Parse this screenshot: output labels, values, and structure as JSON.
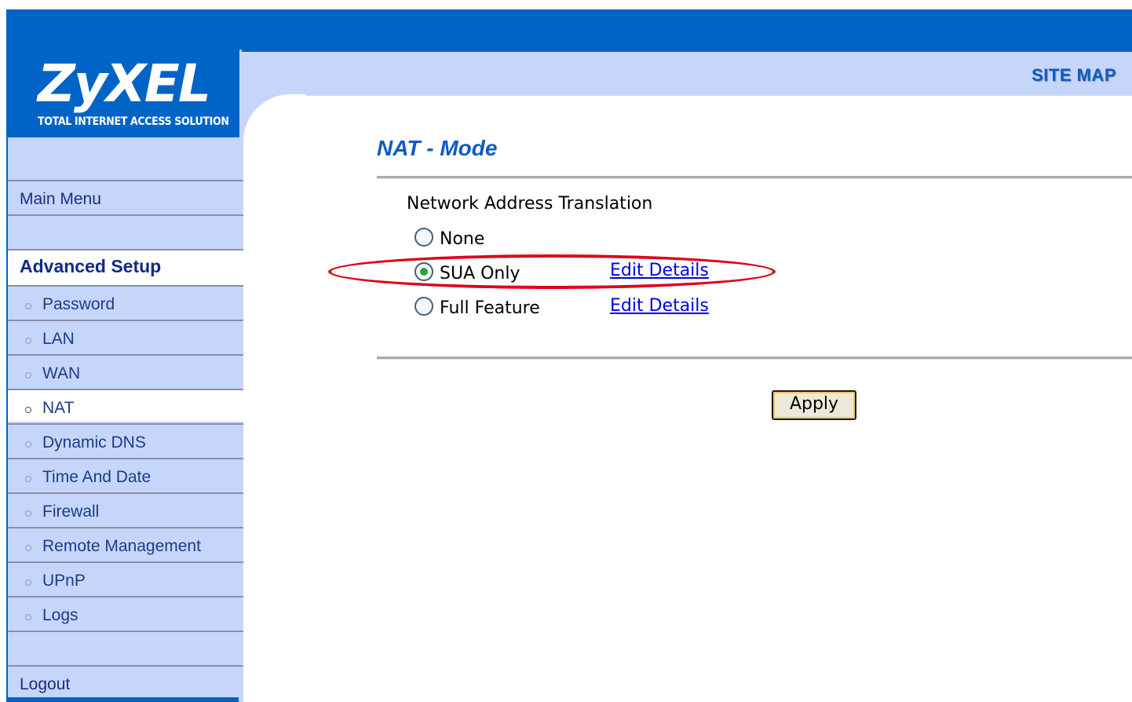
{
  "brand": {
    "logo_text": "ZyXEL",
    "tagline": "TOTAL INTERNET ACCESS SOLUTION",
    "primary_color": "#0063c6",
    "light_color": "#c6d6fb"
  },
  "header": {
    "site_map_label": "SITE MAP"
  },
  "sidebar": {
    "main_menu": "Main Menu",
    "section_title": "Advanced Setup",
    "items": [
      {
        "label": "Password",
        "active": false
      },
      {
        "label": "LAN",
        "active": false
      },
      {
        "label": "WAN",
        "active": false
      },
      {
        "label": "NAT",
        "active": true
      },
      {
        "label": "Dynamic DNS",
        "active": false
      },
      {
        "label": "Time And Date",
        "active": false
      },
      {
        "label": "Firewall",
        "active": false
      },
      {
        "label": "Remote Management",
        "active": false
      },
      {
        "label": "UPnP",
        "active": false
      },
      {
        "label": "Logs",
        "active": false
      }
    ],
    "logout": "Logout"
  },
  "main": {
    "title": "NAT - Mode",
    "group_label": "Network Address Translation",
    "options": [
      {
        "label": "None",
        "checked": false,
        "link": ""
      },
      {
        "label": "SUA Only",
        "checked": true,
        "link": "Edit Details"
      },
      {
        "label": "Full Feature",
        "checked": false,
        "link": "Edit Details"
      }
    ],
    "apply_label": "Apply",
    "highlight_color": "#e0001b"
  }
}
